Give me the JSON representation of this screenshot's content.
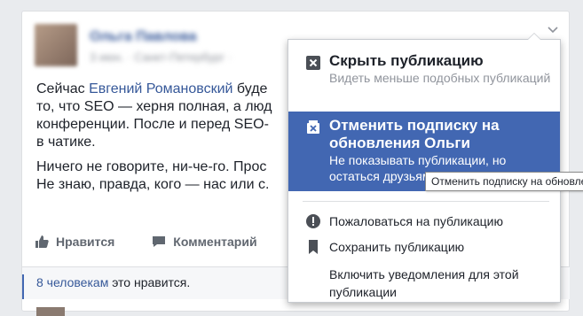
{
  "post": {
    "author": "Ольга Павлова",
    "meta": "3 июн. · Санкт-Петербург · ",
    "text_line1_before": "Сейчас ",
    "text_link": "Евгений Романовский",
    "text_line1_after": " буде",
    "text_line2": "то, что SEO — херня полная, а люд",
    "text_line3": "конференции. После и перед SEO-",
    "text_line4": "в чатике.",
    "text_p2_line1": "Ничего не говорите, ни-че-го. Прос",
    "text_p2_line2": "Не знаю, правда, кого — нас или с."
  },
  "actions": {
    "like": "Нравится",
    "comment": "Комментарий"
  },
  "likes": {
    "count_link": "8 человекам",
    "rest": " это нравится."
  },
  "menu": {
    "hide_title": "Скрыть публикацию",
    "hide_sub": "Видеть меньше подобных публикаций",
    "unfollow_title": "Отменить подписку на обновления Ольги",
    "unfollow_sub": "Не показывать публикации, но остаться друзьям",
    "report": "Пожаловаться на публикацию",
    "save": "Сохранить публикацию",
    "notify": "Включить уведомления для этой публикации"
  },
  "tooltip": "Отменить подписку на обновле",
  "colors": {
    "accent": "#4267b2",
    "link": "#365899"
  }
}
